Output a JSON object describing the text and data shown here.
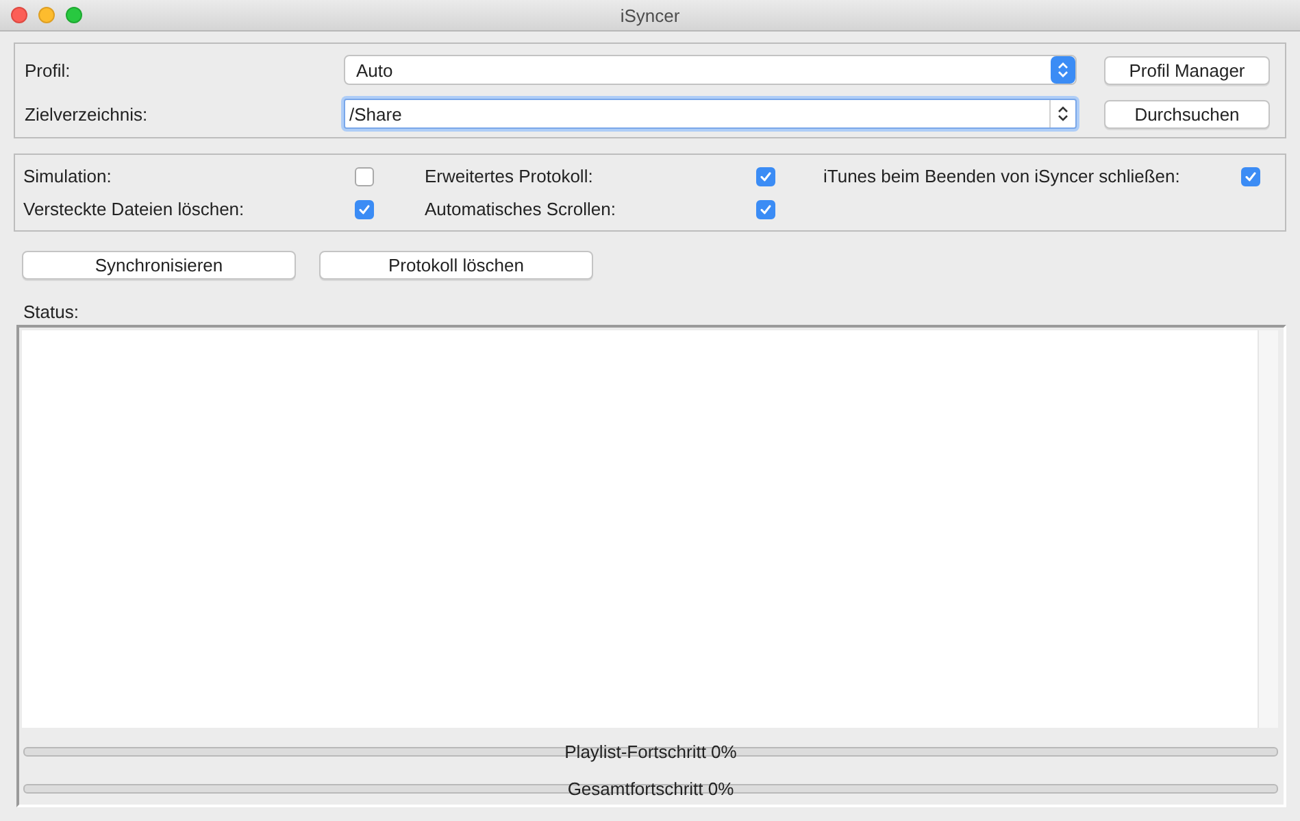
{
  "window": {
    "title": "iSyncer"
  },
  "settings": [
    {
      "label": "Profil:",
      "kind": "select",
      "value": "Auto",
      "button": "Profil Manager",
      "focused": false
    },
    {
      "label": "Zielverzeichnis:",
      "kind": "combo",
      "value": "/Share",
      "button": "Durchsuchen",
      "focused": true
    }
  ],
  "options": [
    {
      "label": "Simulation:",
      "checked": false
    },
    {
      "label": "Erweitertes Protokoll:",
      "checked": true
    },
    {
      "label": "iTunes beim Beenden von iSyncer schließen:",
      "checked": true
    },
    {
      "label": "Versteckte Dateien löschen:",
      "checked": true
    },
    {
      "label": "Automatisches Scrollen:",
      "checked": true
    }
  ],
  "actions": [
    "Synchronisieren",
    "Protokoll löschen"
  ],
  "status": {
    "label": "Status:"
  },
  "progress": [
    {
      "label": "Playlist-Fortschritt 0%",
      "level": 0
    },
    {
      "label": "Gesamtfortschritt 0%",
      "level": 0
    }
  ]
}
